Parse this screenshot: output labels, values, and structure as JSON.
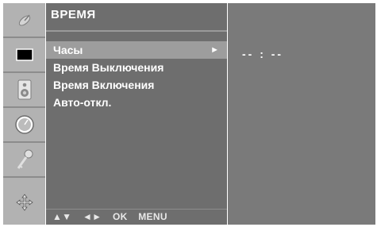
{
  "menu": {
    "title": "ВРЕМЯ",
    "items": [
      {
        "label": "Часы",
        "selected": true,
        "has_submenu": true,
        "arrow": "►"
      },
      {
        "label": "Время Выключения",
        "selected": false
      },
      {
        "label": "Время Включения",
        "selected": false
      },
      {
        "label": "Авто-откл.",
        "selected": false
      }
    ],
    "footer": {
      "updown": "▲▼",
      "leftright": "◄►",
      "ok": "OK",
      "menu": "MENU"
    }
  },
  "value_panel": {
    "time": "-- : --"
  },
  "icons": [
    {
      "name": "satellite-dish-icon"
    },
    {
      "name": "screen-picture-icon"
    },
    {
      "name": "speaker-sound-icon"
    },
    {
      "name": "clock-time-icon"
    },
    {
      "name": "key-lock-icon"
    },
    {
      "name": "setup-arrows-icon"
    }
  ],
  "colors": {
    "icon_column": "#b2b2b2",
    "menu_panel": "#6e6e6e",
    "selected_row": "#9d9d9d",
    "value_panel": "#7a7a7a"
  }
}
